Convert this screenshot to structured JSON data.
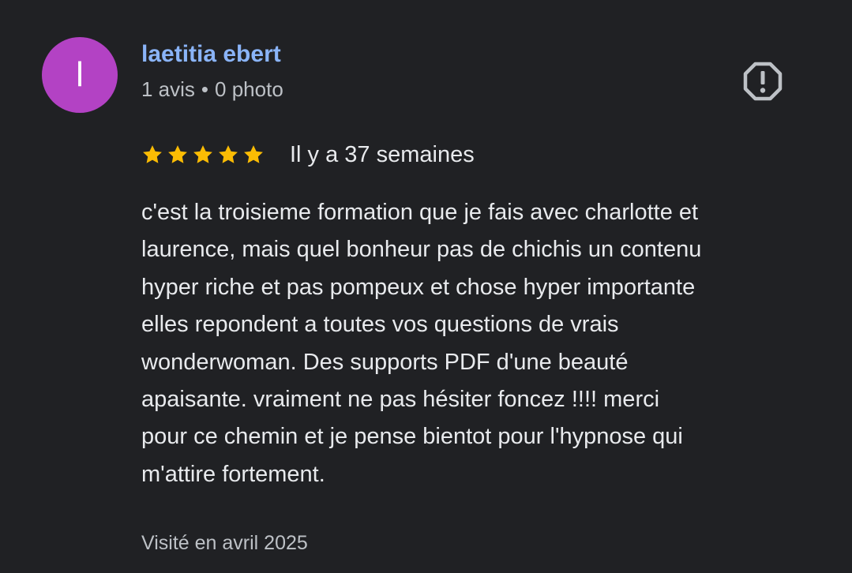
{
  "author": {
    "initial": "l",
    "name": "laetitia ebert",
    "reviews_count": "1 avis",
    "separator": "•",
    "photos_count": "0 photo",
    "avatar_color": "#b342c4",
    "name_color": "#8ab4f8"
  },
  "report_icon": "report-flag-icon",
  "rating": {
    "stars": 5,
    "max": 5,
    "star_color": "#fbbc04",
    "date": "Il y a 37 semaines"
  },
  "review": {
    "text": "c'est la troisieme formation que je fais avec charlotte et\nlaurence, mais quel bonheur pas de chichis un contenu\nhyper riche et pas pompeux et chose hyper importante\nelles repondent a toutes vos questions de vrais\nwonderwoman. Des supports PDF d'une beauté\napaisante. vraiment ne pas hésiter foncez !!!! merci\npour ce chemin et je pense bientot pour l'hypnose qui\nm'attire fortement."
  },
  "visited": "Visité en avril 2025"
}
